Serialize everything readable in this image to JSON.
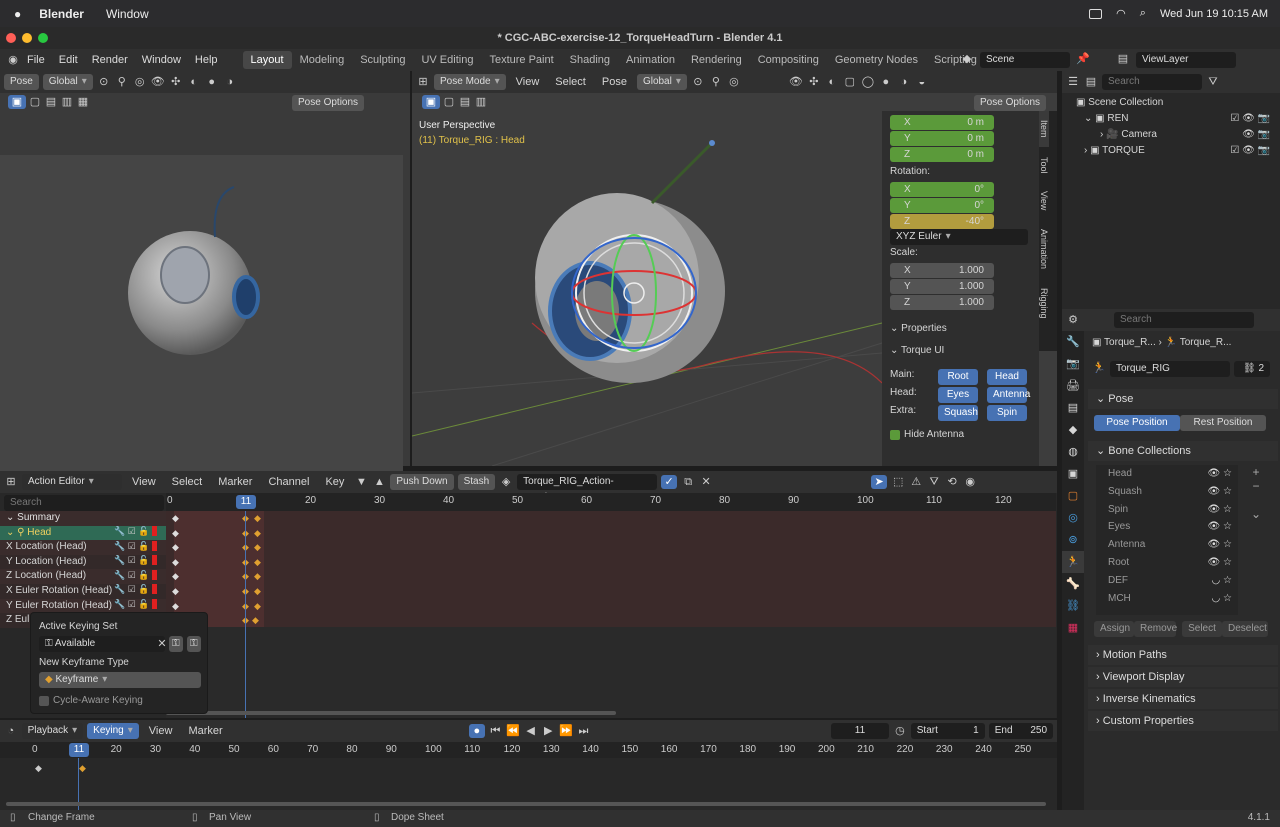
{
  "macos": {
    "menu": [
      "Blender",
      "Window"
    ],
    "clock": "Wed Jun 19  10:15 AM"
  },
  "window": {
    "title": "* CGC-ABC-exercise-12_TorqueHeadTurn - Blender 4.1"
  },
  "topbar": {
    "menus": [
      "File",
      "Edit",
      "Render",
      "Window",
      "Help"
    ],
    "workspaces": [
      "Layout",
      "Modeling",
      "Sculpting",
      "UV Editing",
      "Texture Paint",
      "Shading",
      "Animation",
      "Rendering",
      "Compositing",
      "Geometry Nodes",
      "Scripting"
    ],
    "active_workspace": "Layout",
    "add_tab": "+",
    "scene": "Scene",
    "view_layer": "ViewLayer"
  },
  "left_viewport": {
    "mode": "Pose",
    "orientation": "Global",
    "pose_options": "Pose Options"
  },
  "main_viewport": {
    "mode": "Pose Mode",
    "menus": [
      "View",
      "Select",
      "Pose"
    ],
    "orientation": "Global",
    "pose_options": "Pose Options",
    "overlay_title": "User Perspective",
    "overlay_sub": "(11) Torque_RIG : Head",
    "tabs": [
      "Item",
      "Tool",
      "View",
      "Animation",
      "Rigging"
    ]
  },
  "npanel": {
    "location": [
      {
        "axis": "X",
        "value": "0 m"
      },
      {
        "axis": "Y",
        "value": "0 m"
      },
      {
        "axis": "Z",
        "value": "0 m"
      }
    ],
    "rotation_label": "Rotation:",
    "rotation": [
      {
        "axis": "X",
        "value": "0°"
      },
      {
        "axis": "Y",
        "value": "0°"
      },
      {
        "axis": "Z",
        "value": "-40°"
      }
    ],
    "rotation_mode": "XYZ Euler",
    "scale_label": "Scale:",
    "scale": [
      {
        "axis": "X",
        "value": "1.000"
      },
      {
        "axis": "Y",
        "value": "1.000"
      },
      {
        "axis": "Z",
        "value": "1.000"
      }
    ],
    "properties": "Properties",
    "torque_ui": "Torque UI",
    "main_label": "Main:",
    "head_label": "Head:",
    "extra_label": "Extra:",
    "buttons": {
      "root": "Root",
      "head": "Head",
      "eyes": "Eyes",
      "antenna": "Antenna",
      "squash": "Squash",
      "spin": "Spin"
    },
    "hide_antenna": "Hide Antenna"
  },
  "dope": {
    "editor": "Action Editor",
    "menus": [
      "View",
      "Select",
      "Marker",
      "Channel",
      "Key"
    ],
    "push_down": "Push Down",
    "stash": "Stash",
    "action": "Torque_RIG_Action-HeadTurn",
    "search_placeholder": "Search",
    "current_frame": "11",
    "ruler": [
      "0",
      "10",
      "20",
      "30",
      "40",
      "50",
      "60",
      "70",
      "80",
      "90",
      "100",
      "110",
      "120"
    ],
    "channels": [
      "Summary",
      "Head",
      "X Location (Head)",
      "Y Location (Head)",
      "Z Location (Head)",
      "X Euler Rotation (Head)",
      "Y Euler Rotation (Head)",
      "Z Eul"
    ]
  },
  "keying_popup": {
    "active_set_label": "Active Keying Set",
    "active_set": "Available",
    "new_type_label": "New Keyframe Type",
    "new_type": "Keyframe",
    "cycle_aware": "Cycle-Aware Keying"
  },
  "timeline": {
    "menus": [
      "Playback",
      "Keying",
      "View",
      "Marker"
    ],
    "current_frame": "11",
    "start_label": "Start",
    "start": "1",
    "end_label": "End",
    "end": "250",
    "ruler": [
      "0",
      "10",
      "20",
      "30",
      "40",
      "50",
      "60",
      "70",
      "80",
      "90",
      "100",
      "110",
      "120",
      "130",
      "140",
      "150",
      "160",
      "170",
      "180",
      "190",
      "200",
      "210",
      "220",
      "230",
      "240",
      "250"
    ]
  },
  "outliner": {
    "search_placeholder": "Search",
    "items": [
      {
        "label": "Scene Collection",
        "indent": 0
      },
      {
        "label": "REN",
        "indent": 1
      },
      {
        "label": "Camera",
        "indent": 2
      },
      {
        "label": "TORQUE",
        "indent": 1
      }
    ]
  },
  "properties": {
    "search_placeholder": "Search",
    "breadcrumb": [
      "Torque_R...",
      "Torque_R..."
    ],
    "armature": "Torque_RIG",
    "users": "2",
    "pose": "Pose",
    "pose_position": "Pose Position",
    "rest_position": "Rest Position",
    "bone_collections": "Bone Collections",
    "collections": [
      "Head",
      "Squash",
      "Spin",
      "Eyes",
      "Antenna",
      "Root",
      "DEF",
      "MCH"
    ],
    "assign": "Assign",
    "remove": "Remove",
    "select": "Select",
    "deselect": "Deselect",
    "sections": [
      "Motion Paths",
      "Viewport Display",
      "Inverse Kinematics",
      "Custom Properties"
    ]
  },
  "status": {
    "items": [
      "Change Frame",
      "Pan View",
      "Dope Sheet"
    ],
    "version": "4.1.1"
  }
}
